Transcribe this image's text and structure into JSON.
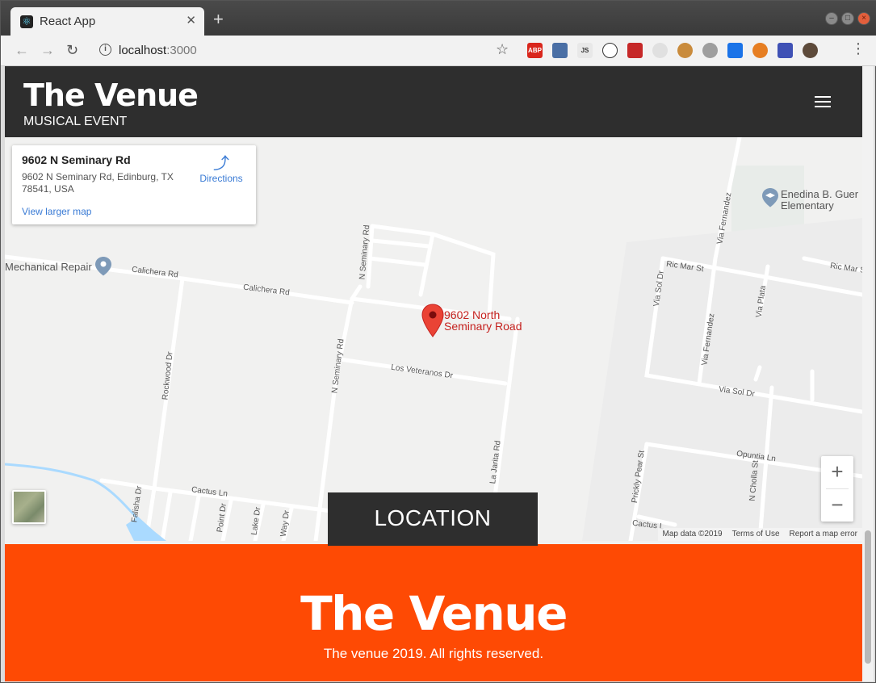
{
  "browser": {
    "tab_title": "React App",
    "tab_close": "✕",
    "new_tab": "+",
    "url_host": "localhost",
    "url_port": ":3000",
    "extensions": [
      "ABP",
      "JS"
    ]
  },
  "header": {
    "logo": "The Venue",
    "subtitle": "MUSICAL EVENT"
  },
  "map": {
    "card": {
      "title": "9602 N Seminary Rd",
      "address": "9602 N Seminary Rd, Edinburg, TX 78541, USA",
      "directions_label": "Directions",
      "larger_map_link": "View larger map"
    },
    "pin_label_line1": "9602 North",
    "pin_label_line2": "Seminary Road",
    "school_line1": "Enedina B. Guer",
    "school_line2": "Elementary",
    "streets": {
      "mechanical_repair": "Mechanical Repair",
      "calichera_rd_1": "Calichera Rd",
      "calichera_rd_2": "Calichera Rd",
      "n_seminary_rd_top": "N Seminary Rd",
      "n_seminary_rd": "N Seminary Rd",
      "los_veteranos": "Los Veteranos Dr",
      "rockwood": "Rockwood Dr",
      "la_jarita": "La Jarita Rd",
      "cactus_ln": "Cactus Ln",
      "falisha": "Falisha Dr",
      "point_dr": "Point Dr",
      "lake_dr": "Lake Dr",
      "way_dr": "Way Dr",
      "ric_mar_st_1": "Ric Mar St",
      "ric_mar_st_2": "Ric Mar S",
      "via_fernandez_top": "Via Fernandez",
      "via_fernandez": "Via Fernandez",
      "via_sol_dr_v": "Via Sol Dr",
      "via_plata": "Via Plata",
      "via_sol_dr": "Via Sol Dr",
      "opuntia": "Opuntia Ln",
      "prickly_pear": "Prickly Pear St",
      "n_cholla": "N Cholla St",
      "cactus_ln_2": "Cactus L"
    },
    "zoom_in": "+",
    "zoom_out": "−",
    "attribution": {
      "map_data": "Map data ©2019",
      "terms": "Terms of Use",
      "report": "Report a map error"
    }
  },
  "location_label": "LOCATION",
  "footer": {
    "logo": "The Venue",
    "copyright": "The venue 2019. All rights reserved."
  },
  "colors": {
    "header_bg": "#2e2e2e",
    "footer_bg": "#fe4a04",
    "pin": "#ea4335",
    "link": "#3a7bd5"
  }
}
